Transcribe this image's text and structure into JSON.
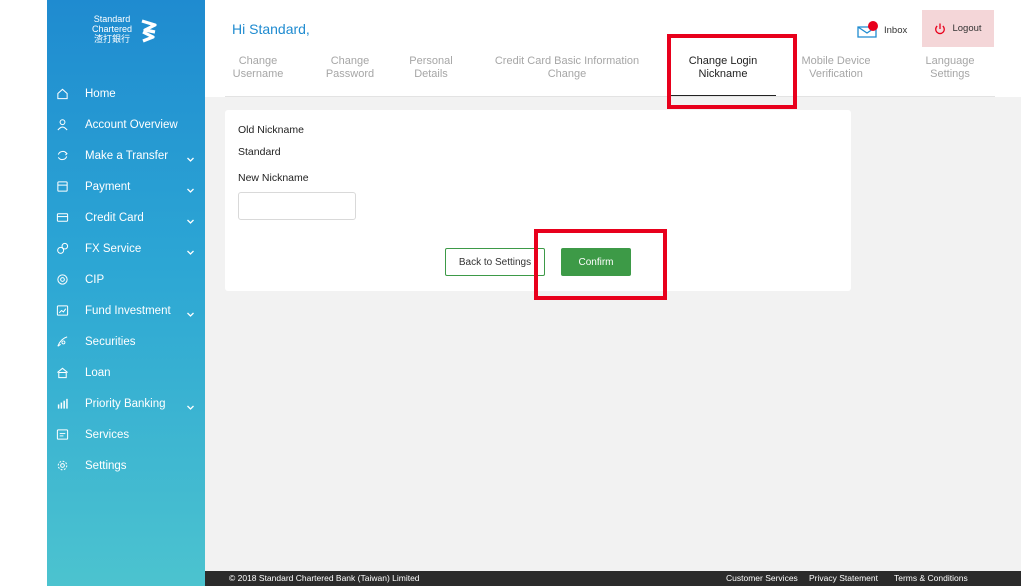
{
  "brand": {
    "logo_line1": "Standard",
    "logo_line2": "Chartered",
    "logo_line3": "渣打銀行",
    "blue": "#1f8bd0",
    "green": "#3d9a47"
  },
  "header": {
    "greeting": "Hi Standard,",
    "inbox_label": "Inbox",
    "logout_label": "Logout"
  },
  "sidebar": {
    "items": [
      {
        "label": "Home",
        "icon": "home-icon",
        "has_chevron": false
      },
      {
        "label": "Account Overview",
        "icon": "user-icon",
        "has_chevron": false
      },
      {
        "label": "Make a Transfer",
        "icon": "transfer-icon",
        "has_chevron": true
      },
      {
        "label": "Payment",
        "icon": "payment-icon",
        "has_chevron": true
      },
      {
        "label": "Credit Card",
        "icon": "credit-card-icon",
        "has_chevron": true
      },
      {
        "label": "FX Service",
        "icon": "fx-icon",
        "has_chevron": true
      },
      {
        "label": "CIP",
        "icon": "cip-icon",
        "has_chevron": false
      },
      {
        "label": "Fund Investment",
        "icon": "fund-icon",
        "has_chevron": true
      },
      {
        "label": "Securities",
        "icon": "securities-icon",
        "has_chevron": false
      },
      {
        "label": "Loan",
        "icon": "loan-icon",
        "has_chevron": false
      },
      {
        "label": "Priority Banking",
        "icon": "priority-banking-icon",
        "has_chevron": true
      },
      {
        "label": "Services",
        "icon": "services-icon",
        "has_chevron": false
      },
      {
        "label": "Settings",
        "icon": "gear-icon",
        "has_chevron": false
      }
    ]
  },
  "tabs": [
    {
      "line1": "Change",
      "line2": "Username",
      "active": false
    },
    {
      "line1": "Change",
      "line2": "Password",
      "active": false
    },
    {
      "line1": "Personal",
      "line2": "Details",
      "active": false
    },
    {
      "line1": "Credit Card Basic Information",
      "line2": "Change",
      "active": false
    },
    {
      "line1": "Change Login",
      "line2": "Nickname",
      "active": true
    },
    {
      "line1": "Mobile Device",
      "line2": "Verification",
      "active": false
    },
    {
      "line1": "Language",
      "line2": "Settings",
      "active": false
    }
  ],
  "form": {
    "old_label": "Old Nickname",
    "old_value": "Standard",
    "new_label": "New Nickname",
    "new_value": "",
    "back_label": "Back to Settings",
    "confirm_label": "Confirm"
  },
  "footer": {
    "copyright": "© 2018 Standard Chartered Bank (Taiwan) Limited",
    "customer_services": "Customer Services",
    "privacy": "Privacy Statement",
    "terms": "Terms & Conditions"
  }
}
